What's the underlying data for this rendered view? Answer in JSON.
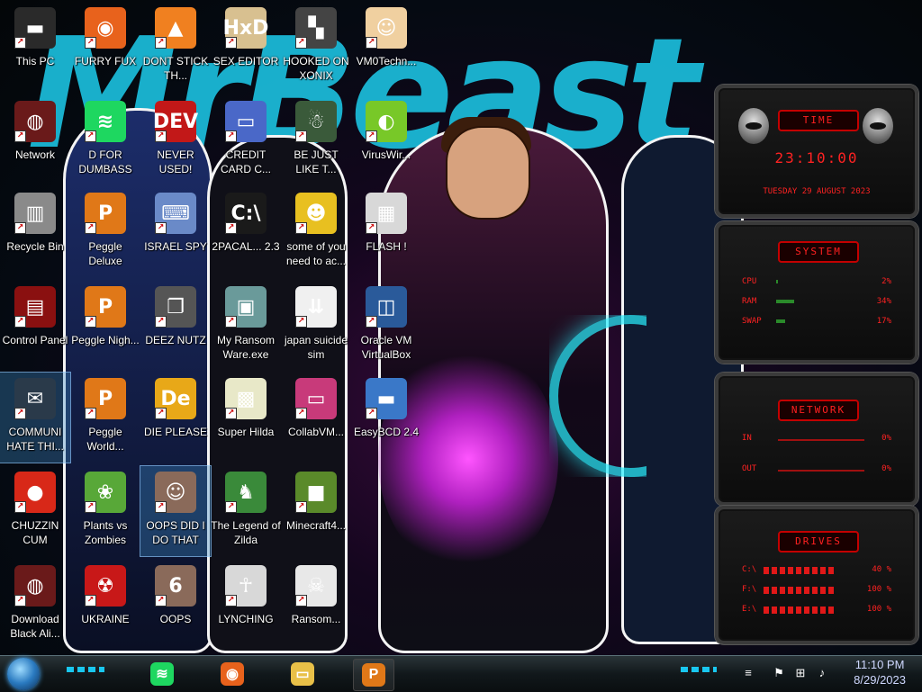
{
  "wallpaper": {
    "banner_text": "MrBeast"
  },
  "desktop_icons": [
    {
      "label": "This PC",
      "color": "#2a2a2a",
      "glyph": "▬"
    },
    {
      "label": "FURRY FUX",
      "color": "#e8621c",
      "glyph": "◉"
    },
    {
      "label": "DONT STICK TH...",
      "color": "#f08020",
      "glyph": "▲"
    },
    {
      "label": "SEX EDITOR",
      "color": "#d8c090",
      "glyph": "HxD"
    },
    {
      "label": "HOOKED ON XONIX",
      "color": "#444444",
      "glyph": "▚"
    },
    {
      "label": "VM0Techn...",
      "color": "#f0d0a0",
      "glyph": "☺"
    },
    {
      "label": "Network",
      "color": "#6a1a1a",
      "glyph": "◍"
    },
    {
      "label": "D FOR DUMBASS",
      "color": "#1ed760",
      "glyph": "≋"
    },
    {
      "label": "NEVER USED!",
      "color": "#c21818",
      "glyph": "DEV"
    },
    {
      "label": "CREDIT CARD C...",
      "color": "#4a68c8",
      "glyph": "▭"
    },
    {
      "label": "BE JUST LIKE T...",
      "color": "#3a5a3a",
      "glyph": "☃"
    },
    {
      "label": "VirusWir...",
      "color": "#78c828",
      "glyph": "◐"
    },
    {
      "label": "Recycle Bin",
      "color": "#8a8a8a",
      "glyph": "▥"
    },
    {
      "label": "Peggle Deluxe",
      "color": "#e07818",
      "glyph": "P"
    },
    {
      "label": "ISRAEL SPY",
      "color": "#6a8ac8",
      "glyph": "⌨"
    },
    {
      "label": "2PACAL... 2.3",
      "color": "#1a1a1a",
      "glyph": "C:\\"
    },
    {
      "label": "some of you need to ac...",
      "color": "#e8c020",
      "glyph": "☻"
    },
    {
      "label": "FLASH !",
      "color": "#d8d8d8",
      "glyph": "▦"
    },
    {
      "label": "Control Panel",
      "color": "#8a1010",
      "glyph": "▤"
    },
    {
      "label": "Peggle Nigh...",
      "color": "#e07818",
      "glyph": "P"
    },
    {
      "label": "DEEZ NUTZ",
      "color": "#555555",
      "glyph": "❐"
    },
    {
      "label": "My Ransom Ware.exe",
      "color": "#6a9a9a",
      "glyph": "▣"
    },
    {
      "label": "japan suicide sim",
      "color": "#f0f0f0",
      "glyph": "⇊"
    },
    {
      "label": "Oracle VM VirtualBox",
      "color": "#2a5a9a",
      "glyph": "◫"
    },
    {
      "label": "COMMUNI HATE THI...",
      "color": "#2a3a4a",
      "glyph": "✉"
    },
    {
      "label": "Peggle World...",
      "color": "#e07818",
      "glyph": "P"
    },
    {
      "label": "DIE PLEASE",
      "color": "#e8a818",
      "glyph": "De"
    },
    {
      "label": "Super Hilda",
      "color": "#e8e8c8",
      "glyph": "▩"
    },
    {
      "label": "CollabVM...",
      "color": "#c83a7a",
      "glyph": "▭"
    },
    {
      "label": "EasyBCD 2.4",
      "color": "#3a78c8",
      "glyph": "▬"
    },
    {
      "label": "CHUZZIN CUM",
      "color": "#d82818",
      "glyph": "●"
    },
    {
      "label": "Plants vs Zombies",
      "color": "#58a838",
      "glyph": "❀"
    },
    {
      "label": "OOPS DID I DO THAT",
      "color": "#8a6a5a",
      "glyph": "☺"
    },
    {
      "label": "The Legend of Zilda",
      "color": "#3a8a3a",
      "glyph": "♞"
    },
    {
      "label": "Minecraft4...",
      "color": "#5a8a2a",
      "glyph": "■"
    },
    {
      "label": "Download Black Ali...",
      "color": "#6a1a1a",
      "glyph": "◍"
    },
    {
      "label": "UKRAINE",
      "color": "#c81818",
      "glyph": "☢"
    },
    {
      "label": "OOPS",
      "color": "#8a6a5a",
      "glyph": "6"
    },
    {
      "label": "LYNCHING",
      "color": "#d8d8d8",
      "glyph": "☥"
    },
    {
      "label": "Ransom...",
      "color": "#e8e8e8",
      "glyph": "☠"
    }
  ],
  "gadget": {
    "time": {
      "title": "TIME",
      "clock": "23:10:00",
      "date": "TUESDAY 29 AUGUST 2023"
    },
    "system": {
      "title": "SYSTEM",
      "rows": [
        {
          "name": "CPU",
          "value": "2%",
          "level": 0.02
        },
        {
          "name": "RAM",
          "value": "34%",
          "level": 0.34
        },
        {
          "name": "SWAP",
          "value": "17%",
          "level": 0.17
        }
      ]
    },
    "network": {
      "title": "NETWORK",
      "rows": [
        {
          "name": "IN",
          "value": "0%"
        },
        {
          "name": "OUT",
          "value": "0%"
        }
      ]
    },
    "drives": {
      "title": "DRIVES",
      "rows": [
        {
          "name": "C:\\",
          "value": "40 %"
        },
        {
          "name": "F:\\",
          "value": "100 %"
        },
        {
          "name": "E:\\",
          "value": "100 %"
        }
      ]
    }
  },
  "taskbar": {
    "start_icon": "windows-orb",
    "pinned": [
      {
        "name": "spotify",
        "color": "#1ed760",
        "glyph": "≋"
      },
      {
        "name": "firefox",
        "color": "#e8621c",
        "glyph": "◉"
      },
      {
        "name": "file-explorer",
        "color": "#e8c048",
        "glyph": "▭"
      },
      {
        "name": "peggle",
        "color": "#e07818",
        "glyph": "P",
        "active": true
      }
    ],
    "clock_time": "11:10 PM",
    "clock_date": "8/29/2023"
  }
}
